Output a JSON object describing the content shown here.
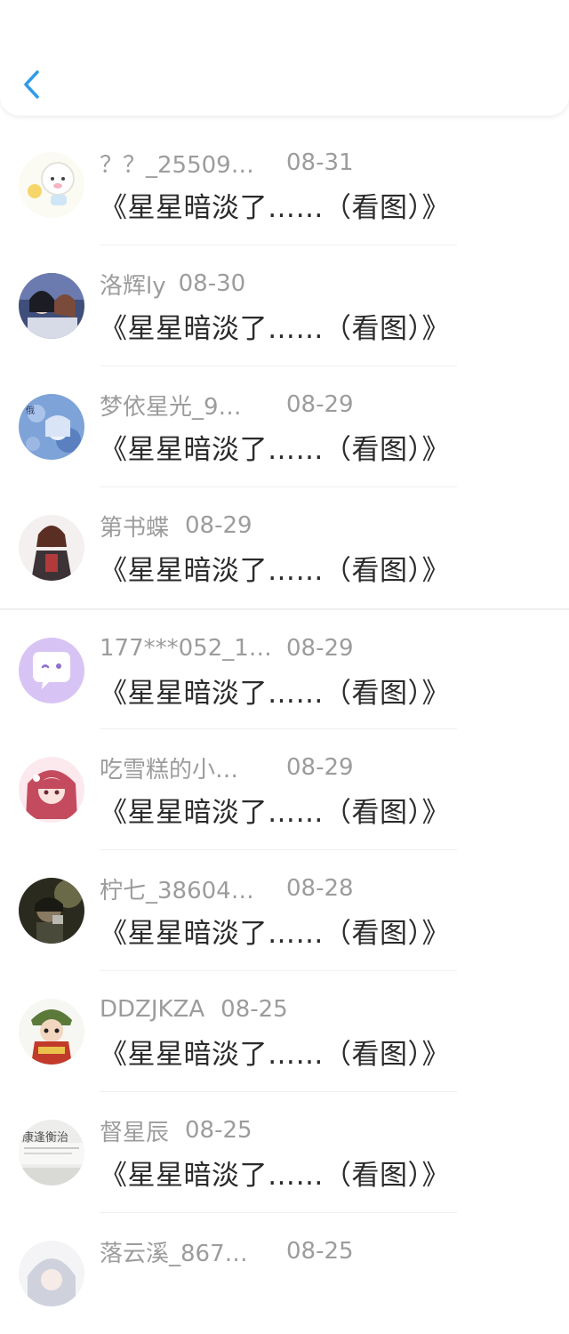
{
  "nav": {
    "back_icon": "chevron-left-icon",
    "accent": "#2f9be8"
  },
  "items": [
    {
      "user": "？？_25509…",
      "date": "08-31",
      "title": "《星星暗淡了……（看图）》"
    },
    {
      "user": "洛辉ly",
      "date": "08-30",
      "title": "《星星暗淡了……（看图）》"
    },
    {
      "user": "梦依星光_9…",
      "date": "08-29",
      "title": "《星星暗淡了……（看图）》"
    },
    {
      "user": "第书蝶",
      "date": "08-29",
      "title": "《星星暗淡了……（看图）》"
    },
    {
      "user": "177***052_1…",
      "date": "08-29",
      "title": "《星星暗淡了……（看图）》"
    },
    {
      "user": "吃雪糕的小…",
      "date": "08-29",
      "title": "《星星暗淡了……（看图）》"
    },
    {
      "user": "柠七_38604…",
      "date": "08-28",
      "title": "《星星暗淡了……（看图）》"
    },
    {
      "user": "DDZJKZA",
      "date": "08-25",
      "title": "《星星暗淡了……（看图）》"
    },
    {
      "user": "督星辰",
      "date": "08-25",
      "title": "《星星暗淡了……（看图）》"
    },
    {
      "user": "落云溪_867…",
      "date": "08-25",
      "title": ""
    }
  ]
}
